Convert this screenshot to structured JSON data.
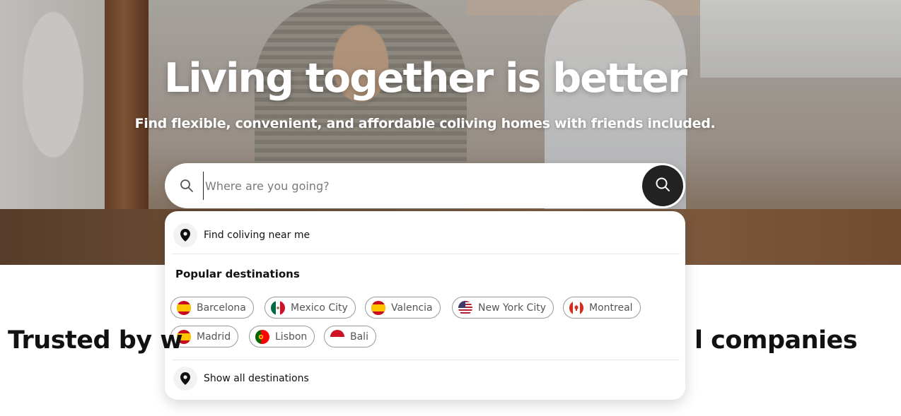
{
  "hero": {
    "title": "Living together is better",
    "subtitle": "Find flexible, convenient, and affordable coliving homes with friends included."
  },
  "search": {
    "placeholder": "Where are you going?",
    "value": "",
    "leading_icon": "search-icon",
    "submit_icon": "search-icon"
  },
  "dropdown": {
    "near_me_label": "Find coliving near me",
    "near_me_icon": "location-pin-icon",
    "popular_title": "Popular destinations",
    "destinations": [
      {
        "name": "Barcelona",
        "flag": "spain"
      },
      {
        "name": "Mexico City",
        "flag": "mexico"
      },
      {
        "name": "Valencia",
        "flag": "spain"
      },
      {
        "name": "New York City",
        "flag": "usa"
      },
      {
        "name": "Montreal",
        "flag": "canada"
      },
      {
        "name": "Madrid",
        "flag": "spain"
      },
      {
        "name": "Lisbon",
        "flag": "portugal"
      },
      {
        "name": "Bali",
        "flag": "indonesia"
      }
    ],
    "show_all_label": "Show all destinations",
    "show_all_icon": "location-pin-icon"
  },
  "trusted": {
    "left_text": "Trusted by w",
    "right_text": "l companies"
  },
  "colors": {
    "accent_dark": "#222222",
    "chip_border": "#9a9a9a",
    "text_primary": "#111111"
  }
}
